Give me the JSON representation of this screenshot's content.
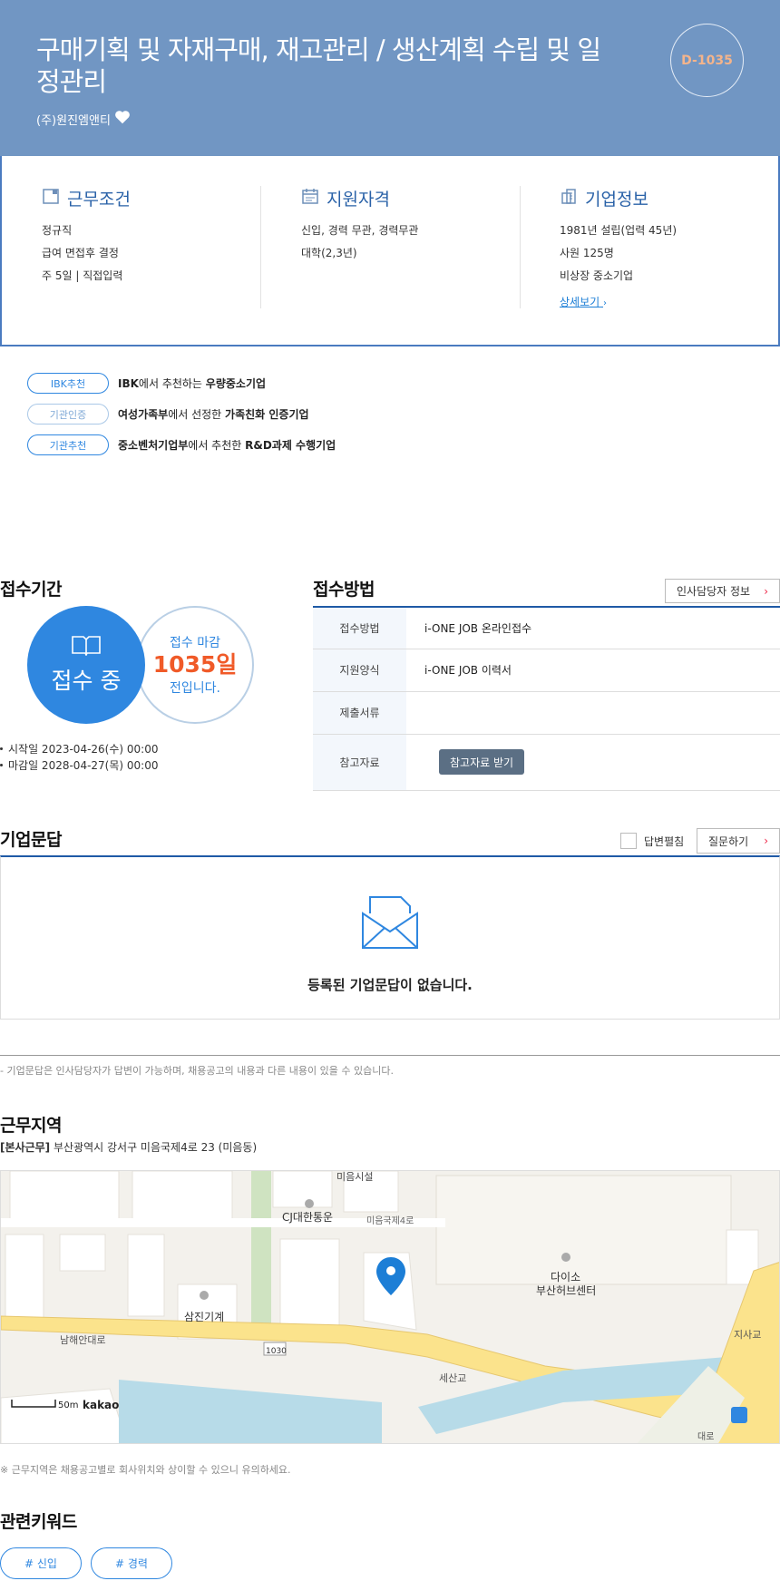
{
  "header": {
    "title": "구매기획 및 자재구매, 재고관리 / 생산계획 수립 및 일정관리",
    "company": "(주)원진엠앤티",
    "dday": "D-1035"
  },
  "info": {
    "work": {
      "title": "근무조건",
      "lines": [
        "정규직",
        "급여 면접후 결정",
        "주 5일 | 직접입력"
      ]
    },
    "qualification": {
      "title": "지원자격",
      "lines": [
        "신입, 경력 무관, 경력무관",
        "대학(2,3년)"
      ]
    },
    "company": {
      "title": "기업정보",
      "lines": [
        "1981년 설립(업력 45년)",
        "사원 125명",
        "비상장 중소기업"
      ],
      "detail_link": "상세보기"
    }
  },
  "badges": [
    {
      "label": "IBK추천",
      "pre": "",
      "b1": "IBK",
      "mid": "에서 추천하는 ",
      "b2": "우량중소기업"
    },
    {
      "label": "기관인증",
      "pre": "",
      "b1": "여성가족부",
      "mid": "에서 선정한 ",
      "b2": "가족친화 인증기업"
    },
    {
      "label": "기관추천",
      "pre": "",
      "b1": "중소벤처기업부",
      "mid": "에서 추천한 ",
      "b2": "R&D과제 수행기업"
    }
  ],
  "period": {
    "title": "접수기간",
    "status": "접수 중",
    "deadline_label": "접수 마감",
    "deadline_days": "1035일",
    "deadline_suffix": "전입니다.",
    "start": "시작일 2023-04-26(수) 00:00",
    "end": "마감일 2028-04-27(목) 00:00"
  },
  "apply": {
    "title": "접수방법",
    "hr_button": "인사담당자 정보",
    "rows": [
      {
        "label": "접수방법",
        "value": "i-ONE JOB 온라인접수"
      },
      {
        "label": "지원양식",
        "value": "i-ONE JOB 이력서"
      },
      {
        "label": "제출서류",
        "value": ""
      },
      {
        "label": "참고자료",
        "value": ""
      }
    ],
    "ref_button": "참고자료 받기"
  },
  "qa": {
    "title": "기업문답",
    "toggle_label": "답변펼침",
    "ask_button": "질문하기",
    "empty": "등록된 기업문답이 없습니다.",
    "note": "- 기업문답은 인사담당자가 답변이 가능하며, 채용공고의 내용과 다른 내용이 있을 수 있습니다."
  },
  "location": {
    "title": "근무지역",
    "tag": "[본사근무]",
    "address": "부산광역시 강서구 미음국제4로 23 (미음동)",
    "map_labels": {
      "top": "미음시설",
      "cj": "CJ대한통운",
      "road1": "미음국제4로",
      "daiso1": "다이소",
      "daiso2": "부산허브센터",
      "samjin": "삼진기계",
      "namhae": "남해안대로",
      "route": "1030",
      "sesan": "세산교",
      "jisa": "지사교",
      "bottom_road": "대로",
      "scale": "50m",
      "brand": "kakao"
    },
    "note": "※ 근무지역은 채용공고별로 회사위치와 상이할 수 있으니 유의하세요."
  },
  "keywords": {
    "title": "관련키워드",
    "items": [
      "# 신입",
      "# 경력"
    ]
  }
}
